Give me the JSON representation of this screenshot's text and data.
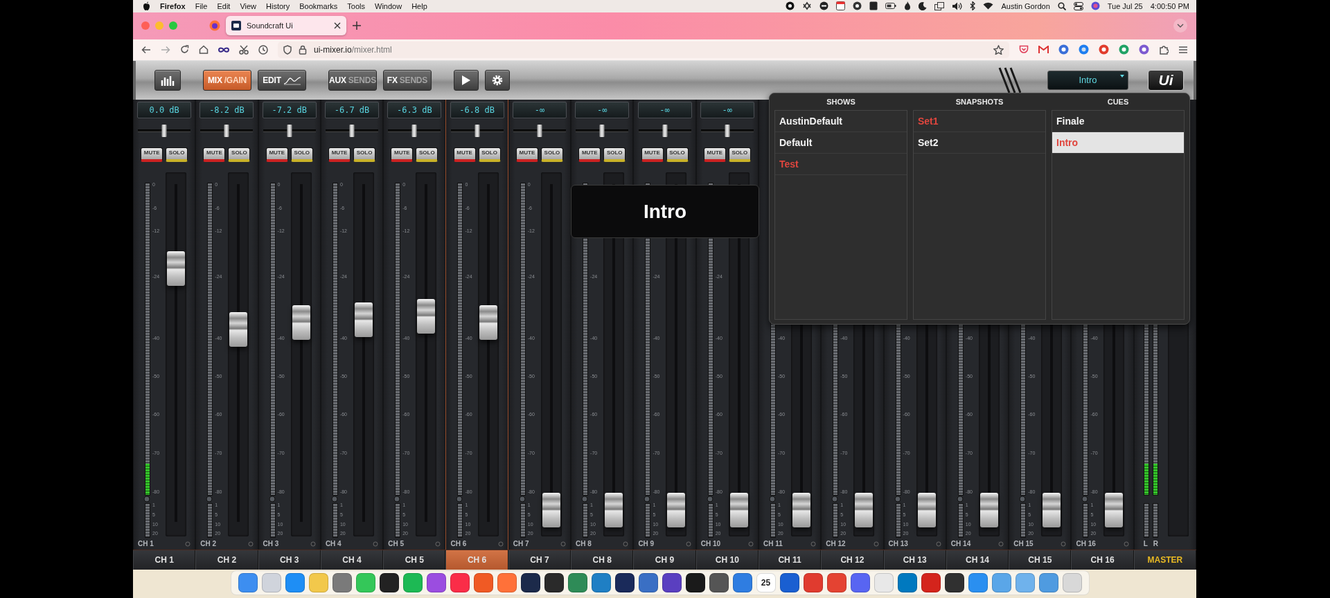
{
  "menu_bar": {
    "app": "Firefox",
    "items": [
      "File",
      "Edit",
      "View",
      "History",
      "Bookmarks",
      "Tools",
      "Window",
      "Help"
    ],
    "user": "Austin Gordon",
    "date": "Tue Jul 25",
    "time": "4:00:50 PM"
  },
  "browser": {
    "tabs": [
      {
        "title": "Soundcraft Ui",
        "selected": true
      }
    ],
    "url_domain": "ui-mixer.io",
    "url_path": "/mixer.html"
  },
  "toolbar": {
    "views": [
      {
        "kind": "meters",
        "selected": false
      },
      {
        "kind": "split",
        "main": "MIX",
        "sub": "/GAIN",
        "selected": true
      },
      {
        "kind": "edit",
        "main": "EDIT",
        "selected": false
      },
      {
        "kind": "split",
        "main": "AUX",
        "sub": "SENDS",
        "selected": false
      },
      {
        "kind": "split",
        "main": "FX",
        "sub": "SENDS",
        "selected": false
      }
    ],
    "cue_select": "Intro",
    "logo": "Ui"
  },
  "channels": [
    {
      "readout": "0.0 dB",
      "pan": {
        "level": 0.5
      },
      "mute": {
        "label": "MUTE",
        "on": false
      },
      "solo": {
        "label": "SOLO",
        "on": false
      },
      "scale": [
        "0",
        "-6",
        "-12",
        "-24",
        "-40",
        "-50",
        "-60",
        "-70",
        "-80",
        "1",
        "5",
        "10",
        "20"
      ],
      "fader": {
        "level": 0.75
      },
      "meter": {
        "level": 0.1
      },
      "label": "CH 1"
    },
    {
      "readout": "-8.2 dB",
      "pan": {
        "level": 0.5
      },
      "mute": {
        "label": "MUTE",
        "on": false
      },
      "solo": {
        "label": "SOLO",
        "on": false
      },
      "scale": [
        "0",
        "-6",
        "-12",
        "-24",
        "-40",
        "-50",
        "-60",
        "-70",
        "-80",
        "1",
        "5",
        "10",
        "20"
      ],
      "fader": {
        "level": 0.57
      },
      "label": "CH 2"
    },
    {
      "readout": "-7.2 dB",
      "pan": {
        "level": 0.5
      },
      "mute": {
        "label": "MUTE",
        "on": false
      },
      "solo": {
        "label": "SOLO",
        "on": false
      },
      "scale": [
        "0",
        "-6",
        "-12",
        "-24",
        "-40",
        "-50",
        "-60",
        "-70",
        "-80",
        "1",
        "5",
        "10",
        "20"
      ],
      "fader": {
        "level": 0.59
      },
      "label": "CH 3"
    },
    {
      "readout": "-6.7 dB",
      "pan": {
        "level": 0.5
      },
      "mute": {
        "label": "MUTE",
        "on": false
      },
      "solo": {
        "label": "SOLO",
        "on": false
      },
      "scale": [
        "0",
        "-6",
        "-12",
        "-24",
        "-40",
        "-50",
        "-60",
        "-70",
        "-80",
        "1",
        "5",
        "10",
        "20"
      ],
      "fader": {
        "level": 0.6
      },
      "label": "CH 4"
    },
    {
      "readout": "-6.3 dB",
      "pan": {
        "level": 0.5
      },
      "mute": {
        "label": "MUTE",
        "on": false
      },
      "solo": {
        "label": "SOLO",
        "on": false
      },
      "scale": [
        "0",
        "-6",
        "-12",
        "-24",
        "-40",
        "-50",
        "-60",
        "-70",
        "-80",
        "1",
        "5",
        "10",
        "20"
      ],
      "fader": {
        "level": 0.61
      },
      "label": "CH 5"
    },
    {
      "readout": "-6.8 dB",
      "pan": {
        "level": 0.5
      },
      "mute": {
        "label": "MUTE",
        "on": false
      },
      "solo": {
        "label": "SOLO",
        "on": false
      },
      "scale": [
        "0",
        "-6",
        "-12",
        "-24",
        "-40",
        "-50",
        "-60",
        "-70",
        "-80",
        "1",
        "5",
        "10",
        "20"
      ],
      "fader": {
        "level": 0.59
      },
      "label": "CH 6"
    },
    {
      "readout": "-∞",
      "pan": {
        "level": 0.5
      },
      "mute": {
        "label": "MUTE",
        "on": false
      },
      "solo": {
        "label": "SOLO",
        "on": false
      },
      "scale": [
        "0",
        "-6",
        "-12",
        "-24",
        "-40",
        "-50",
        "-60",
        "-70",
        "-80",
        "1",
        "5",
        "10",
        "20"
      ],
      "fader": {
        "level": 0.035
      },
      "label": "CH 7"
    },
    {
      "readout": "-∞",
      "pan": {
        "level": 0.5
      },
      "mute": {
        "label": "MUTE",
        "on": false
      },
      "solo": {
        "label": "SOLO",
        "on": false
      },
      "scale": [
        "-24",
        "-40",
        "-50",
        "-60",
        "-70",
        "-80",
        "1",
        "5",
        "10",
        "20"
      ],
      "fader": {
        "level": 0.035
      },
      "label": "CH 8"
    },
    {
      "readout": "-∞",
      "pan": {
        "level": 0.5
      },
      "mute": {
        "label": "MUTE",
        "on": false
      },
      "solo": {
        "label": "SOLO",
        "on": false
      },
      "scale": [
        "-24",
        "-40",
        "-50",
        "-60",
        "-70",
        "-80",
        "1",
        "5",
        "10",
        "20"
      ],
      "fader": {
        "level": 0.035
      },
      "label": "CH 9"
    },
    {
      "readout": "-∞",
      "pan": {
        "level": 0.5
      },
      "mute": {
        "label": "MUTE",
        "on": false
      },
      "solo": {
        "label": "SOLO",
        "on": false
      },
      "scale": [
        "-24",
        "-40",
        "-50",
        "-60",
        "-70",
        "-80",
        "1",
        "5",
        "10",
        "20"
      ],
      "fader": {
        "level": 0.035
      },
      "label": "CH 10"
    },
    {
      "scale": [
        "-40",
        "-50",
        "-60",
        "-70",
        "-80",
        "1",
        "5",
        "10",
        "20"
      ],
      "fader": {
        "level": 0.035
      },
      "label": "CH 11"
    },
    {
      "scale": [
        "-40",
        "-50",
        "-60",
        "-70",
        "-80",
        "1",
        "5",
        "10",
        "20"
      ],
      "fader": {
        "level": 0.035
      },
      "label": "CH 12"
    },
    {
      "scale": [
        "-40",
        "-50",
        "-60",
        "-70",
        "-80",
        "1",
        "5",
        "10",
        "20"
      ],
      "fader": {
        "level": 0.035
      },
      "label": "CH 13"
    },
    {
      "scale": [
        "-40",
        "-50",
        "-60",
        "-70",
        "-80",
        "1",
        "5",
        "10",
        "20"
      ],
      "fader": {
        "level": 0.035
      },
      "label": "CH 14"
    },
    {
      "scale": [
        "-40",
        "-50",
        "-60",
        "-70",
        "-80",
        "1",
        "5",
        "10",
        "20"
      ],
      "fader": {
        "level": 0.035
      },
      "label": "CH 15"
    },
    {
      "scale": [
        "-40",
        "-50",
        "-60",
        "-70",
        "-80",
        "1",
        "5",
        "10",
        "20"
      ],
      "fader": {
        "level": 0.035
      },
      "label": "CH 16"
    }
  ],
  "master": {
    "meters": [
      {
        "label": "L",
        "level": 0.1
      },
      {
        "label": "R",
        "level": 0.1
      }
    ]
  },
  "channel_tabs": [
    {
      "label": "CH 1",
      "kind": "channel",
      "selected": false
    },
    {
      "label": "CH 2",
      "kind": "channel",
      "selected": false
    },
    {
      "label": "CH 3",
      "kind": "channel",
      "selected": false
    },
    {
      "label": "CH 4",
      "kind": "channel",
      "selected": false
    },
    {
      "label": "CH 5",
      "kind": "channel",
      "selected": false
    },
    {
      "label": "CH 6",
      "kind": "channel",
      "selected": true
    },
    {
      "label": "CH 7",
      "kind": "channel",
      "selected": false
    },
    {
      "label": "CH 8",
      "kind": "channel",
      "selected": false
    },
    {
      "label": "CH 9",
      "kind": "channel",
      "selected": false
    },
    {
      "label": "CH 10",
      "kind": "channel",
      "selected": false
    },
    {
      "label": "CH 11",
      "kind": "channel",
      "selected": false
    },
    {
      "label": "CH 12",
      "kind": "channel",
      "selected": false
    },
    {
      "label": "CH 13",
      "kind": "channel",
      "selected": false
    },
    {
      "label": "CH 14",
      "kind": "channel",
      "selected": false
    },
    {
      "label": "CH 15",
      "kind": "channel",
      "selected": false
    },
    {
      "label": "CH 16",
      "kind": "channel",
      "selected": false
    },
    {
      "label": "MASTER",
      "kind": "master",
      "selected": false
    }
  ],
  "banner": "Intro",
  "popup": {
    "columns": [
      {
        "title": "SHOWS",
        "items": [
          {
            "label": "AustinDefault",
            "loaded": false,
            "selected": false
          },
          {
            "label": "Default",
            "loaded": false,
            "selected": false
          },
          {
            "label": "Test",
            "loaded": true,
            "selected": false
          }
        ]
      },
      {
        "title": "SNAPSHOTS",
        "items": [
          {
            "label": "Set1",
            "loaded": true,
            "selected": false
          },
          {
            "label": "Set2",
            "loaded": false,
            "selected": false
          }
        ]
      },
      {
        "title": "CUES",
        "items": [
          {
            "label": "Finale",
            "loaded": false,
            "selected": false
          },
          {
            "label": "Intro",
            "loaded": true,
            "selected": true
          }
        ]
      }
    ]
  },
  "dock": {
    "apps": [
      {
        "color": "#3d8ef0"
      },
      {
        "color": "#d0d4dc"
      },
      {
        "color": "#1e8ef5"
      },
      {
        "color": "#f2c84b"
      },
      {
        "color": "#7a7a7a"
      },
      {
        "color": "#34c759"
      },
      {
        "color": "#222222"
      },
      {
        "color": "#1db954"
      },
      {
        "color": "#9b4de0"
      },
      {
        "color": "#fa2d48"
      },
      {
        "color": "#f05a24"
      },
      {
        "color": "#ff7139"
      },
      {
        "color": "#1c2a4a"
      },
      {
        "color": "#2a2a2a"
      },
      {
        "color": "#2e8b57"
      },
      {
        "color": "#1f7fc4"
      },
      {
        "color": "#1a2a5a"
      },
      {
        "color": "#3a6fc4"
      },
      {
        "color": "#5a3fc0"
      },
      {
        "color": "#1a1a1a"
      },
      {
        "color": "#555555"
      },
      {
        "color": "#2f7de1"
      },
      {
        "color": "#ffffff",
        "label": "25"
      },
      {
        "color": "#1a5fd1"
      },
      {
        "color": "#e03b2f"
      },
      {
        "color": "#e44332"
      },
      {
        "color": "#5865f2"
      },
      {
        "color": "#e8e8e8"
      },
      {
        "color": "#0079bf"
      },
      {
        "color": "#d4241c"
      },
      {
        "color": "#303030"
      },
      {
        "color": "#2a8ff0"
      },
      {
        "color": "#5aa6e8"
      },
      {
        "color": "#6fb2ec"
      },
      {
        "color": "#4f9be0"
      },
      {
        "color": "#d8d8d8"
      }
    ]
  }
}
